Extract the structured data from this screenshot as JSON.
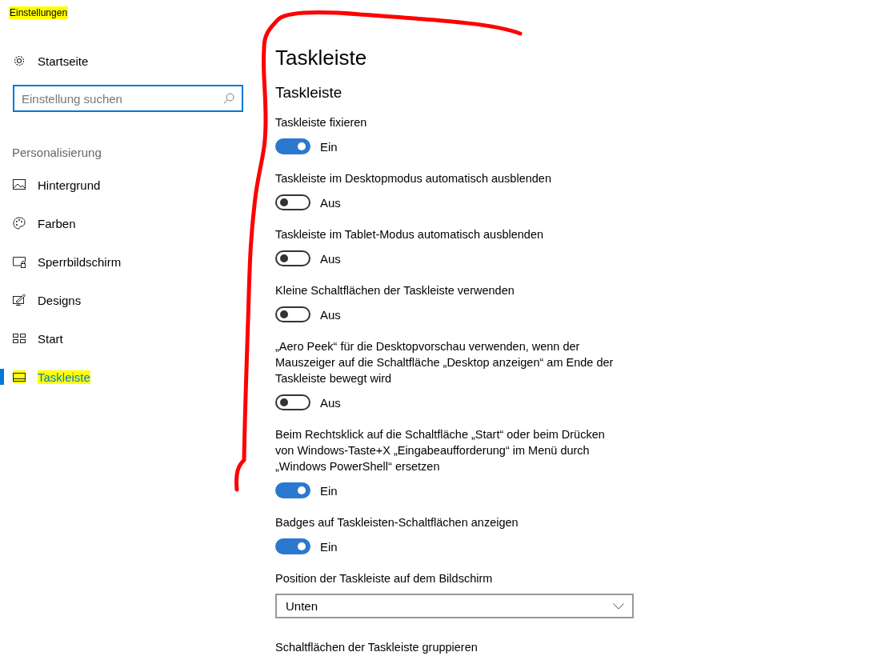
{
  "window": {
    "title": "Einstellungen",
    "highlighted": true
  },
  "sidebar": {
    "home": "Startseite",
    "search": {
      "placeholder": "Einstellung suchen"
    },
    "section": "Personalisierung",
    "items": [
      {
        "label": "Hintergrund",
        "selected": false,
        "highlighted": false
      },
      {
        "label": "Farben",
        "selected": false,
        "highlighted": false
      },
      {
        "label": "Sperrbildschirm",
        "selected": false,
        "highlighted": false
      },
      {
        "label": "Designs",
        "selected": false,
        "highlighted": false
      },
      {
        "label": "Start",
        "selected": false,
        "highlighted": false
      },
      {
        "label": "Taskleiste",
        "selected": true,
        "highlighted": true
      }
    ]
  },
  "page": {
    "title": "Taskleiste",
    "section": "Taskleiste",
    "settings": [
      {
        "kind": "toggle",
        "label": "Taskleiste fixieren",
        "on": true,
        "state": "Ein"
      },
      {
        "kind": "toggle",
        "label": "Taskleiste im Desktopmodus automatisch ausblenden",
        "on": false,
        "state": "Aus"
      },
      {
        "kind": "toggle",
        "label": "Taskleiste im Tablet-Modus automatisch ausblenden",
        "on": false,
        "state": "Aus"
      },
      {
        "kind": "toggle",
        "label": "Kleine Schaltflächen der Taskleiste verwenden",
        "on": false,
        "state": "Aus"
      },
      {
        "kind": "toggle",
        "label": "„Aero Peek“ für die Desktopvorschau verwenden, wenn der Mauszeiger auf die Schaltfläche „Desktop anzeigen“ am Ende der Taskleiste bewegt wird",
        "on": false,
        "state": "Aus"
      },
      {
        "kind": "toggle",
        "label": "Beim Rechtsklick auf die Schaltfläche „Start“ oder beim Drücken von Windows-Taste+X „Eingabeaufforderung“ im Menü durch „Windows PowerShell“ ersetzen",
        "on": true,
        "state": "Ein"
      },
      {
        "kind": "toggle",
        "label": "Badges auf Taskleisten-Schaltflächen anzeigen",
        "on": true,
        "state": "Ein"
      },
      {
        "kind": "dropdown",
        "label": "Position der Taskleiste auf dem Bildschirm",
        "value": "Unten"
      },
      {
        "kind": "heading",
        "label": "Schaltflächen der Taskleiste gruppieren"
      }
    ]
  },
  "annotations": [
    {
      "kind": "freehand-stroke",
      "color": "#ff0000"
    }
  ]
}
